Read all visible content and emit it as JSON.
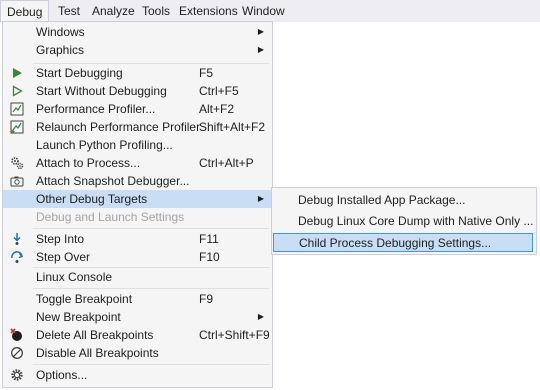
{
  "menubar": {
    "items": [
      "Debug",
      "Test",
      "Analyze",
      "Tools",
      "Extensions",
      "Window"
    ]
  },
  "debug_menu": {
    "items": [
      {
        "label": "Windows",
        "shortcut": "",
        "submenu": true
      },
      {
        "label": "Graphics",
        "shortcut": "",
        "submenu": true
      },
      {
        "label": "Start Debugging",
        "shortcut": "F5",
        "icon": "play-icon"
      },
      {
        "label": "Start Without Debugging",
        "shortcut": "Ctrl+F5",
        "icon": "play-outline-icon"
      },
      {
        "label": "Performance Profiler...",
        "shortcut": "Alt+F2",
        "icon": "performance-profiler-icon"
      },
      {
        "label": "Relaunch Performance Profiler",
        "shortcut": "Shift+Alt+F2",
        "icon": "relaunch-profiler-icon"
      },
      {
        "label": "Launch Python Profiling...",
        "shortcut": ""
      },
      {
        "label": "Attach to Process...",
        "shortcut": "Ctrl+Alt+P",
        "icon": "attach-gears-icon"
      },
      {
        "label": "Attach Snapshot Debugger...",
        "shortcut": "",
        "icon": "camera-icon"
      },
      {
        "label": "Other Debug Targets",
        "shortcut": "",
        "submenu": true,
        "highlighted": true
      },
      {
        "label": "Debug and Launch Settings",
        "shortcut": "",
        "disabled": true
      },
      {
        "label": "Step Into",
        "shortcut": "F11",
        "icon": "step-into-icon"
      },
      {
        "label": "Step Over",
        "shortcut": "F10",
        "icon": "step-over-icon"
      },
      {
        "label": "Linux Console",
        "shortcut": ""
      },
      {
        "label": "Toggle Breakpoint",
        "shortcut": "F9"
      },
      {
        "label": "New Breakpoint",
        "shortcut": "",
        "submenu": true
      },
      {
        "label": "Delete All Breakpoints",
        "shortcut": "Ctrl+Shift+F9",
        "icon": "delete-breakpoints-icon"
      },
      {
        "label": "Disable All Breakpoints",
        "shortcut": "",
        "icon": "disable-breakpoints-icon"
      },
      {
        "label": "Options...",
        "shortcut": "",
        "icon": "gear-icon"
      }
    ]
  },
  "other_debug_targets_submenu": {
    "items": [
      {
        "label": "Debug Installed App Package..."
      },
      {
        "label": "Debug Linux Core Dump with Native Only ..."
      },
      {
        "label": "Child Process Debugging Settings...",
        "highlighted": true
      }
    ]
  },
  "colors": {
    "highlight": "#c9def5",
    "highlight_border": "#3399ff",
    "menu_bg": "#f5f5f5",
    "disabled_text": "#a2a4a5",
    "play_green": "#388a34"
  }
}
